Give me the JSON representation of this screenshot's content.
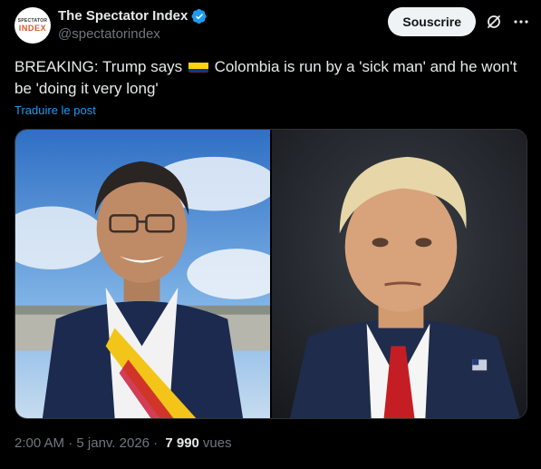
{
  "author": {
    "display_name": "The Spectator Index",
    "handle": "@spectatorindex",
    "avatar_text_top": "SPECTATOR",
    "avatar_text_bottom": "INDEX",
    "verified_icon": "verified-badge-icon"
  },
  "actions": {
    "subscribe_label": "Souscrire",
    "grok_icon": "grok-icon",
    "more_icon": "more-icon"
  },
  "tweet": {
    "text_before_flag": "BREAKING: Trump says ",
    "flag_icon": "colombia-flag-icon",
    "text_after_flag": " Colombia is run by a 'sick man' and he won't be 'doing it very long'",
    "translate_label": "Traduire le post"
  },
  "meta": {
    "time": "2:00 AM",
    "separator1": " · ",
    "date": "5 janv. 2026",
    "separator2": " · ",
    "views_count": "7 990",
    "views_label": "vues"
  },
  "colors": {
    "background": "#000000",
    "text": "#e7e9ea",
    "secondary": "#71767b",
    "link": "#1d9bf0",
    "verified": "#1d9bf0"
  }
}
